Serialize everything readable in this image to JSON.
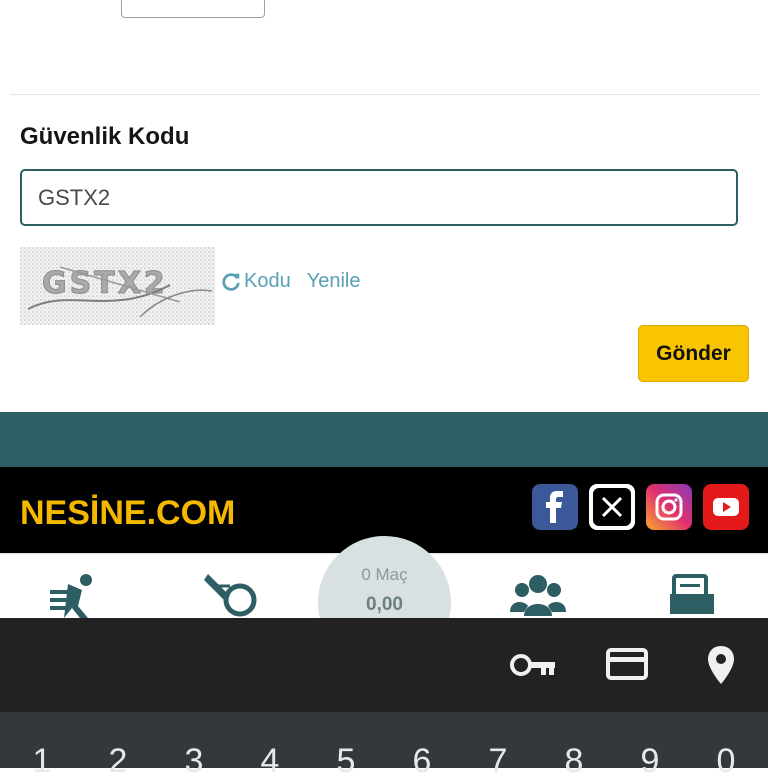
{
  "form": {
    "security_code_label": "Güvenlik Kodu",
    "security_code_value": "GSTX2",
    "captcha_text": "GSTX2",
    "refresh_link_word1": "Kodu",
    "refresh_link_word2": "Yenile",
    "submit_label": "Gönder"
  },
  "footer": {
    "logo_text": "NESİNE.COM",
    "social": [
      "facebook-icon",
      "x-icon",
      "instagram-icon",
      "youtube-icon"
    ]
  },
  "bottom_nav": {
    "coupon_count": "0 Maç",
    "coupon_amount": "0,00"
  },
  "keyboard": {
    "toolbar_icons": [
      "key-icon",
      "card-icon",
      "location-icon"
    ],
    "number_row": [
      "1",
      "2",
      "3",
      "4",
      "5",
      "6",
      "7",
      "8",
      "9",
      "0"
    ]
  },
  "colors": {
    "teal": "#2c5e63",
    "yellow": "#f9c400",
    "link": "#5aa0b4"
  }
}
